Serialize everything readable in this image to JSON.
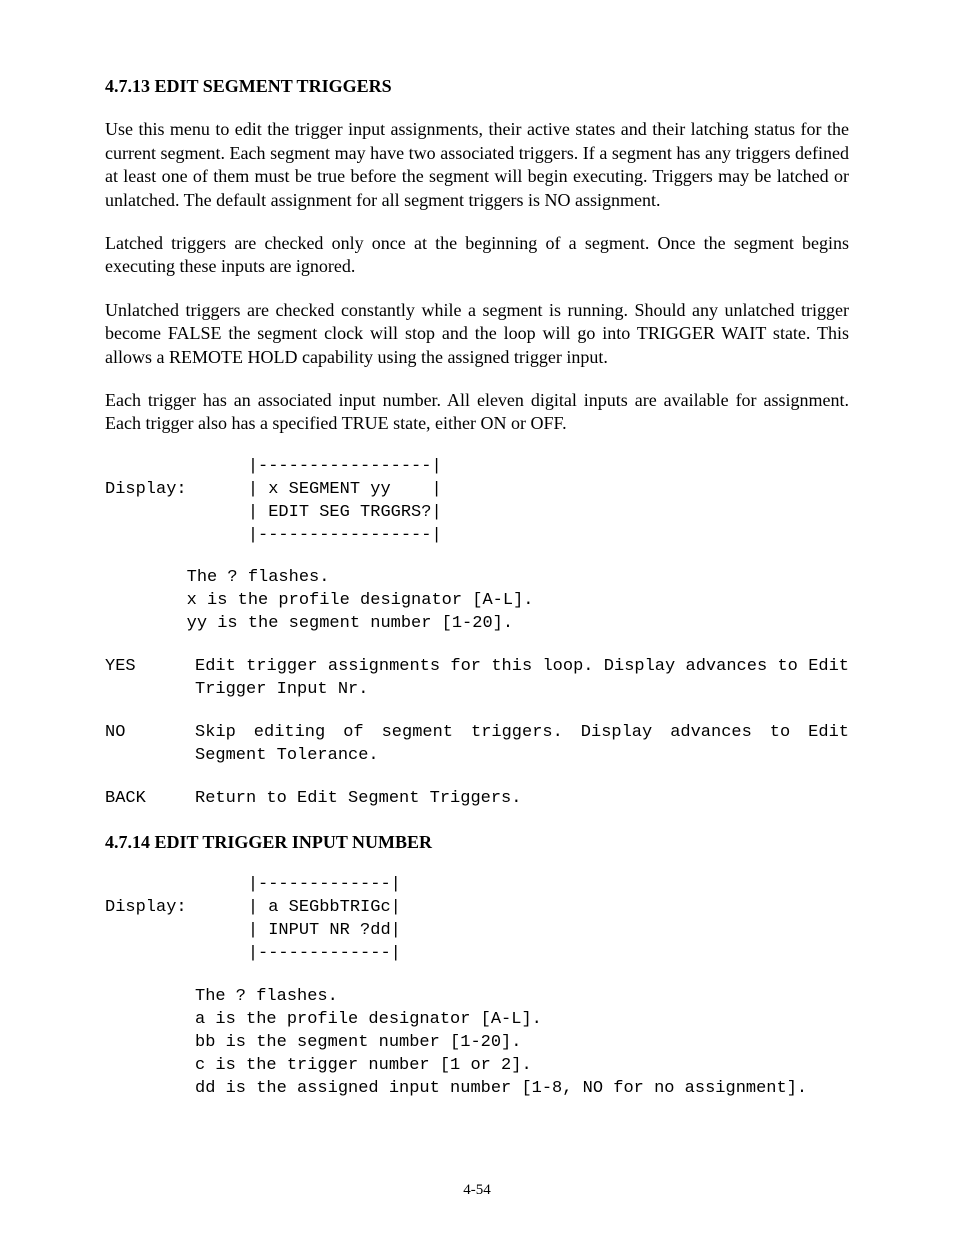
{
  "section1_heading": "4.7.13 EDIT SEGMENT TRIGGERS",
  "para1": "Use this menu to edit the trigger input assignments, their active states and their latching status for the current segment. Each segment may have two associated triggers. If a segment has any triggers defined at least one of them must be true before the segment will begin executing. Triggers may be latched or unlatched. The default assignment for all segment triggers is NO assignment.",
  "para2": "Latched triggers are checked only once at the beginning of a segment. Once the segment begins executing these inputs are ignored.",
  "para3": "Unlatched triggers are checked constantly while a segment is running. Should any unlatched trigger become FALSE the segment clock will stop and the loop will go into TRIGGER WAIT state. This allows a REMOTE HOLD capability using the assigned trigger input.",
  "para4": "Each trigger has an associated input number. All eleven digital inputs are available for assignment. Each trigger also has a specified TRUE state, either ON or OFF.",
  "display1": "              |-----------------|\nDisplay:      | x SEGMENT yy    |\n              | EDIT SEG TRGGRS?|\n              |-----------------|",
  "display1_notes": "        The ? flashes.\n        x is the profile designator [A-L].\n        yy is the segment number [1-20].",
  "yes_label": "YES",
  "yes_desc": "Edit trigger assignments for this loop. Display advances to Edit Trigger Input Nr.",
  "no_label": "NO",
  "no_desc": " Skip editing of segment triggers. Display advances to Edit Segment Tolerance.",
  "back_label": "BACK",
  "back_desc": "Return to Edit Segment Triggers.",
  "section2_heading": "4.7.14 EDIT TRIGGER INPUT NUMBER",
  "display2": "              |-------------|\nDisplay:      | a SEGbbTRIGc|\n              | INPUT NR ?dd|\n              |-------------|",
  "display2_notes": "The ? flashes.\na is the profile designator [A-L].\nbb is the segment number [1-20].\nc is the trigger number [1 or 2].\ndd is the assigned input number [1-8, NO for no assignment].",
  "page_number": "4-54"
}
